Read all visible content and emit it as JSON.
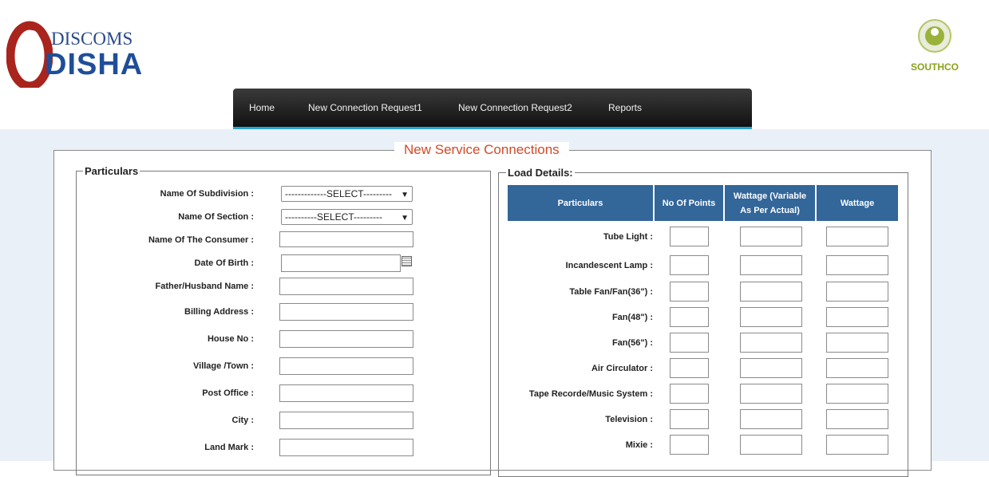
{
  "logo": {
    "word1": "DISCOMS",
    "word2": "DISHA"
  },
  "partner": {
    "name": "SOUTHCO"
  },
  "nav": {
    "items": [
      "Home",
      "New Connection Request1",
      "New Connection Request2",
      "Reports"
    ]
  },
  "page_title": "New Service Connections",
  "particulars": {
    "legend": "Particulars",
    "subdivision": {
      "label": "Name Of Subdivision  :",
      "value": "-------------SELECT---------"
    },
    "section": {
      "label": "Name Of Section  :",
      "value": "----------SELECT---------"
    },
    "consumer": {
      "label": "Name Of The  Consumer  :"
    },
    "dob": {
      "label": "Date Of Birth  :"
    },
    "father": {
      "label": "Father/Husband Name  :"
    },
    "billing": {
      "label": "Billing Address  :"
    },
    "house": {
      "label": "House No  :"
    },
    "village": {
      "label": "Village /Town  :"
    },
    "post": {
      "label": "Post Office :"
    },
    "city": {
      "label": "City  :"
    },
    "landmark": {
      "label": "Land Mark  :"
    }
  },
  "load": {
    "legend": "Load Details:",
    "headers": [
      "Particulars",
      "No Of Points",
      "Wattage (Variable As Per Actual)",
      "Wattage"
    ],
    "rows": [
      "Tube Light  :",
      "Incandescent Lamp  :",
      "Table Fan/Fan(36\")  :",
      "Fan(48\")  :",
      "Fan(56\")  :",
      "Air Circulator  :",
      "Tape Recorde/Music System  :",
      "Television :",
      "Mixie  :"
    ]
  },
  "colors": {
    "accent": "#29a6d8",
    "table_header": "#336699",
    "title": "#d24a26",
    "background": "#eaf0f8"
  }
}
